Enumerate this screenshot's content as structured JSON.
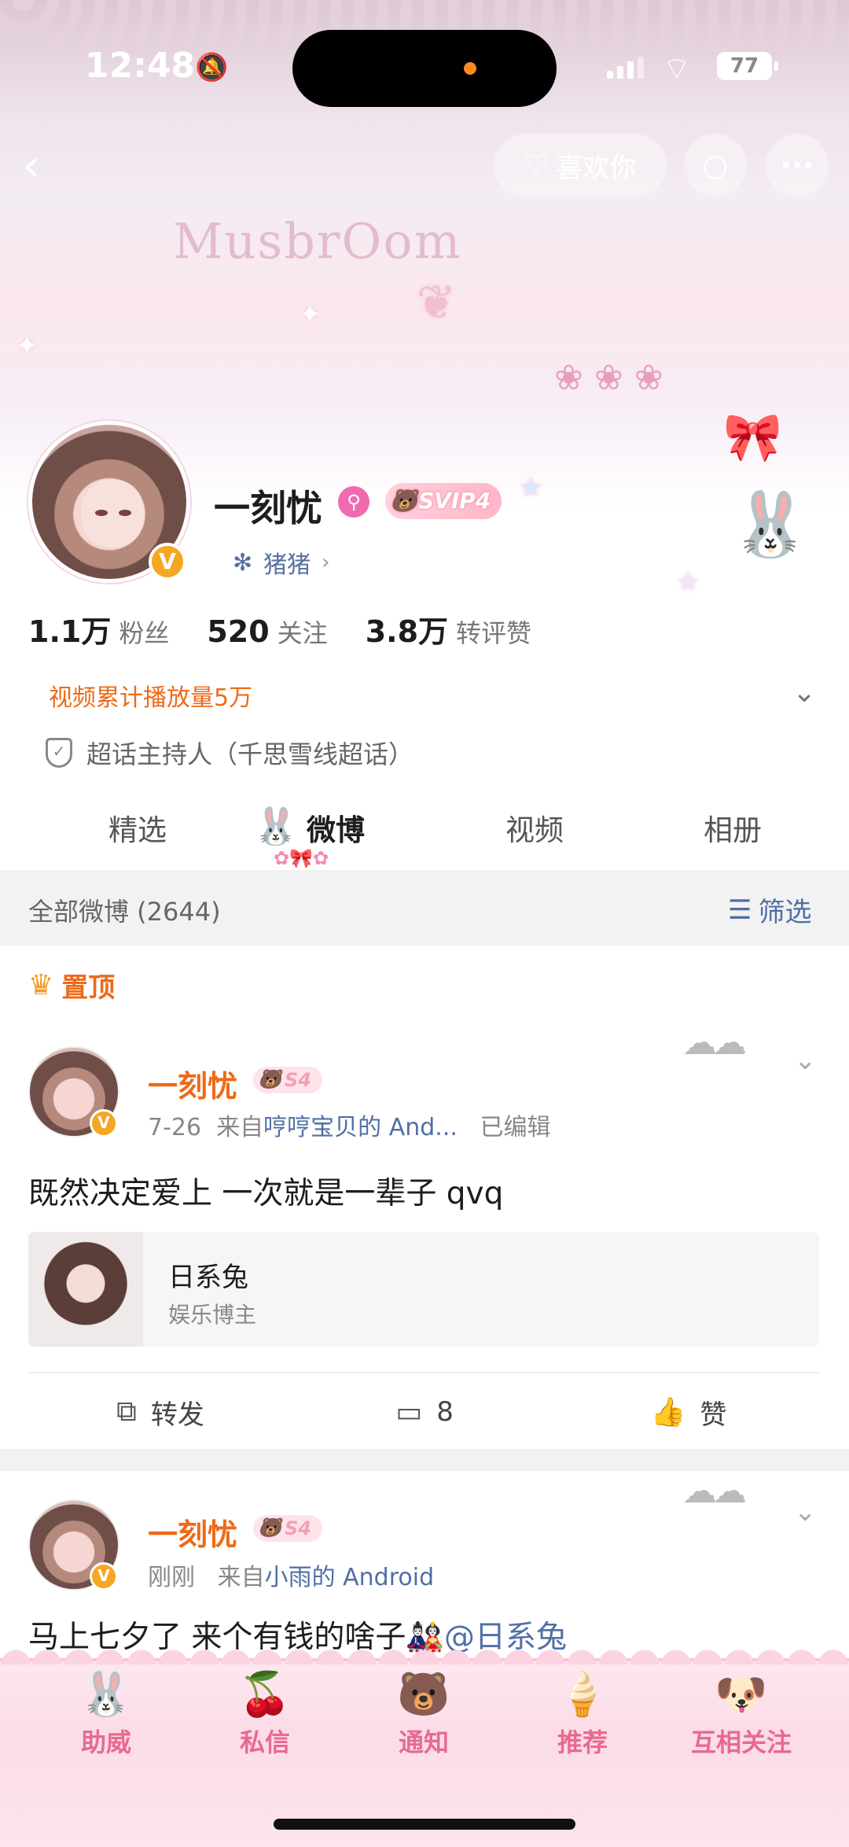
{
  "status_bar": {
    "time": "12:48",
    "battery": "77"
  },
  "nav": {
    "like_label": "喜欢你"
  },
  "profile": {
    "name": "一刻忧",
    "vip_badge": "SVIP4",
    "group": "猪猪",
    "stats": [
      {
        "value": "1.1万",
        "label": "粉丝"
      },
      {
        "value": "520",
        "label": "关注"
      },
      {
        "value": "3.8万",
        "label": "转评赞"
      }
    ],
    "video_total": "视频累计播放量5万",
    "host_role": "超话主持人（千思雪线超话）"
  },
  "tabs": [
    {
      "label": "精选",
      "active": false
    },
    {
      "label": "微博",
      "active": true
    },
    {
      "label": "视频",
      "active": false
    },
    {
      "label": "相册",
      "active": false
    }
  ],
  "feed": {
    "count_label": "全部微博 (2644)",
    "filter_label": "筛选",
    "pinned_label": "置顶",
    "posts": [
      {
        "author": "一刻忧",
        "level": "S4",
        "date": "7-26",
        "from_prefix": "来自",
        "source": "哼哼宝贝的 And...",
        "edited": "已编辑",
        "text": "既然决定爱上 一次就是一辈子 qvq",
        "card": {
          "title": "日系兔",
          "subtitle": "娱乐博主"
        },
        "actions": {
          "repost": "转发",
          "comments": "8",
          "like": "赞"
        }
      },
      {
        "author": "一刻忧",
        "level": "S4",
        "date": "刚刚",
        "from_prefix": "来自",
        "source": "小雨的 Android",
        "text": "马上七夕了 来个有钱的啥子",
        "mention": "@日系兔"
      }
    ]
  },
  "bottom_bar": [
    {
      "label": "助威",
      "icon": "bunny-icon"
    },
    {
      "label": "私信",
      "icon": "cherry-icon"
    },
    {
      "label": "通知",
      "icon": "bear-icon"
    },
    {
      "label": "推荐",
      "icon": "ice-cream-icon"
    },
    {
      "label": "互相关注",
      "icon": "puppy-icon"
    }
  ],
  "colors": {
    "accent_orange": "#ee6a18",
    "link_blue": "#4f6fa6",
    "pink": "#e86a8e"
  }
}
